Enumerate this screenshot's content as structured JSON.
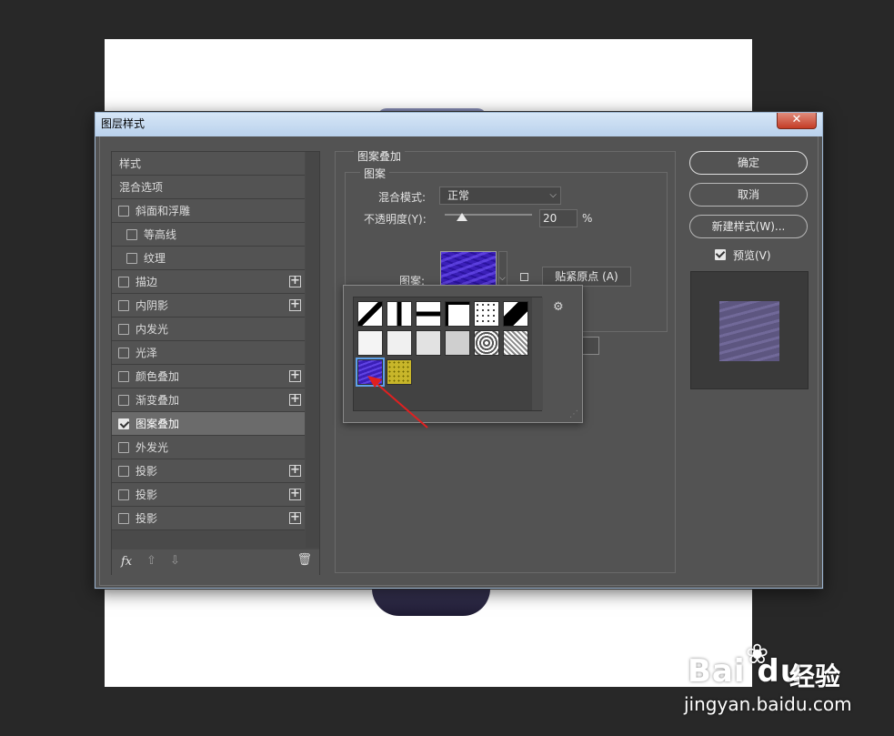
{
  "dialog": {
    "title": "图层样式",
    "close_label": "✕"
  },
  "styles_panel": {
    "items": [
      {
        "label": "样式",
        "type": "header"
      },
      {
        "label": "混合选项",
        "type": "header"
      },
      {
        "label": "斜面和浮雕",
        "checked": false,
        "plus": false,
        "indent": false
      },
      {
        "label": "等高线",
        "checked": false,
        "plus": false,
        "indent": true
      },
      {
        "label": "纹理",
        "checked": false,
        "plus": false,
        "indent": true
      },
      {
        "label": "描边",
        "checked": false,
        "plus": true,
        "indent": false
      },
      {
        "label": "内阴影",
        "checked": false,
        "plus": true,
        "indent": false
      },
      {
        "label": "内发光",
        "checked": false,
        "plus": false,
        "indent": false
      },
      {
        "label": "光泽",
        "checked": false,
        "plus": false,
        "indent": false
      },
      {
        "label": "颜色叠加",
        "checked": false,
        "plus": true,
        "indent": false
      },
      {
        "label": "渐变叠加",
        "checked": false,
        "plus": true,
        "indent": false
      },
      {
        "label": "图案叠加",
        "checked": true,
        "plus": false,
        "indent": false,
        "selected": true
      },
      {
        "label": "外发光",
        "checked": false,
        "plus": false,
        "indent": false
      },
      {
        "label": "投影",
        "checked": false,
        "plus": true,
        "indent": false
      },
      {
        "label": "投影",
        "checked": false,
        "plus": true,
        "indent": false
      },
      {
        "label": "投影",
        "checked": false,
        "plus": true,
        "indent": false
      }
    ],
    "footer": {
      "fx": "fx",
      "up": "⇧",
      "down": "⇩",
      "trash": "🗑"
    }
  },
  "pattern_overlay": {
    "group_title": "图案叠加",
    "sub_title": "图案",
    "blend_mode_label": "混合模式:",
    "blend_mode_value": "正常",
    "opacity_label": "不透明度(Y):",
    "opacity_value": "20",
    "opacity_unit": "%",
    "opacity_fraction": 0.2,
    "pattern_label": "图案:",
    "snap_button": "贴紧原点 (A)",
    "hidden_button_char": "[]"
  },
  "picker": {
    "gear": "⚙",
    "grip": "⋰",
    "selected_index": 12,
    "swatch_count": 14
  },
  "buttons": {
    "ok": "确定",
    "cancel": "取消",
    "new_style": "新建样式(W)...",
    "preview_label": "预览(V)"
  },
  "watermark": {
    "logo": "Bai  du",
    "paw": "❀",
    "brand": "经验",
    "url": "jingyan.baidu.com"
  }
}
